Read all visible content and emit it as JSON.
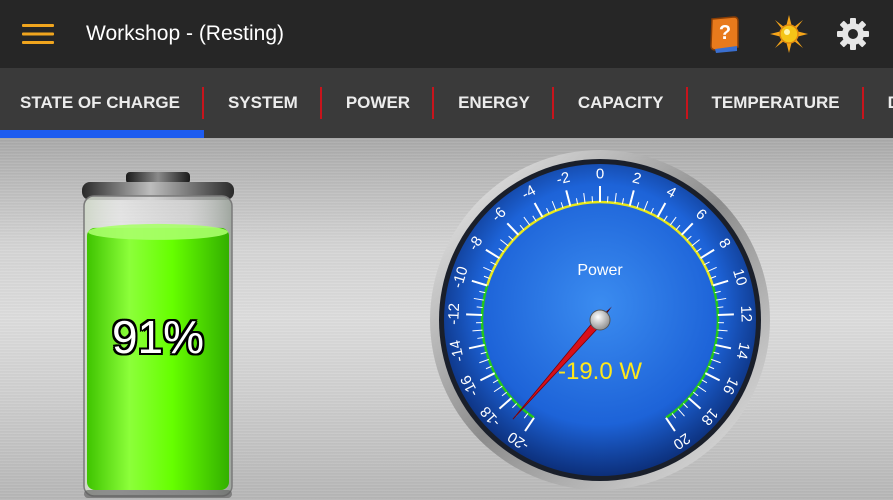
{
  "appbar": {
    "title": "Workshop - (Resting)",
    "menu_icon": "hamburger-menu-icon",
    "actions": [
      {
        "name": "help-book-icon",
        "color": "#e87a1c"
      },
      {
        "name": "brightness-sun-icon",
        "color": "#f5c518"
      },
      {
        "name": "settings-gear-icon",
        "color": "#e0e0e0"
      }
    ]
  },
  "tabs": [
    {
      "label": "STATE OF CHARGE",
      "selected": true
    },
    {
      "label": "SYSTEM",
      "selected": false
    },
    {
      "label": "POWER",
      "selected": false
    },
    {
      "label": "ENERGY",
      "selected": false
    },
    {
      "label": "CAPACITY",
      "selected": false
    },
    {
      "label": "TEMPERATURE",
      "selected": false
    },
    {
      "label": "DA",
      "selected": false
    }
  ],
  "battery": {
    "percent_text": "91%",
    "level": 0.91,
    "fill_color": "#66ff00"
  },
  "gauge": {
    "label": "Power",
    "value": -19.0,
    "readout": "-19.0 W",
    "readout_color": "#ffe81a",
    "scale_min": -20,
    "scale_max": 20,
    "tick_labels": [
      "-20",
      "-18",
      "-16",
      "-14",
      "-12",
      "-10",
      "-8",
      "-6",
      "-4",
      "-2",
      "0",
      "2",
      "4",
      "6",
      "8",
      "10",
      "12",
      "14",
      "16",
      "18",
      "20"
    ],
    "colors": {
      "dial": "#1d63d8",
      "needle": "#d8101a",
      "arc_yellow": "#e8e81a",
      "arc_green": "#22c81a"
    }
  }
}
